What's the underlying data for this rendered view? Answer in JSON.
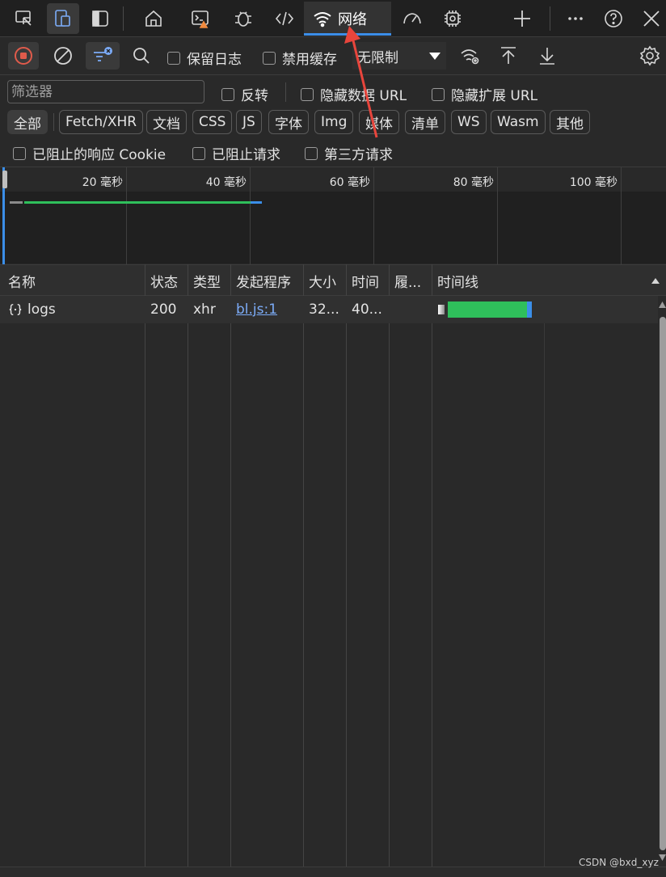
{
  "colors": {
    "accent": "#3b8ee8",
    "record": "#e05b4b",
    "bar_green": "#2fbf5b",
    "bar_blue": "#3b8ee8",
    "annotation_arrow": "#e8453c",
    "warning": "#f08a3e"
  },
  "topbar": {
    "icons": [
      "inspect-icon",
      "device-emulation-icon",
      "dock-icon",
      "welcome-home-icon",
      "console-icon",
      "bug-sources-icon",
      "elements-code-icon",
      "network-wifi-icon",
      "performance-icon",
      "memory-chip-icon",
      "add-tab-icon",
      "more-icon",
      "help-icon",
      "close-icon"
    ],
    "active_tab": "网络"
  },
  "toolbar": {
    "preserve_log": "保留日志",
    "disable_cache": "禁用缓存",
    "throttling": "无限制"
  },
  "filter": {
    "placeholder": "筛选器",
    "invert": "反转",
    "hide_data_url": "隐藏数据 URL",
    "hide_ext_url": "隐藏扩展 URL"
  },
  "types": [
    "全部",
    "Fetch/XHR",
    "文档",
    "CSS",
    "JS",
    "字体",
    "Img",
    "媒体",
    "清单",
    "WS",
    "Wasm",
    "其他"
  ],
  "blocked": {
    "cookies": "已阻止的响应 Cookie",
    "requests": "已阻止请求",
    "third_party": "第三方请求"
  },
  "overview": {
    "ticks": [
      "20 毫秒",
      "40 毫秒",
      "60 毫秒",
      "80 毫秒",
      "100 毫秒"
    ]
  },
  "table": {
    "headers": [
      "名称",
      "状态",
      "类型",
      "发起程序",
      "大小",
      "时间",
      "履...",
      "时间线"
    ],
    "rows": [
      {
        "name": "logs",
        "status": "200",
        "type": "xhr",
        "initiator": "bl.js:1",
        "size": "32...",
        "time": "40...",
        "fulfilled": ""
      }
    ]
  },
  "watermark": "CSDN @bxd_xyz"
}
